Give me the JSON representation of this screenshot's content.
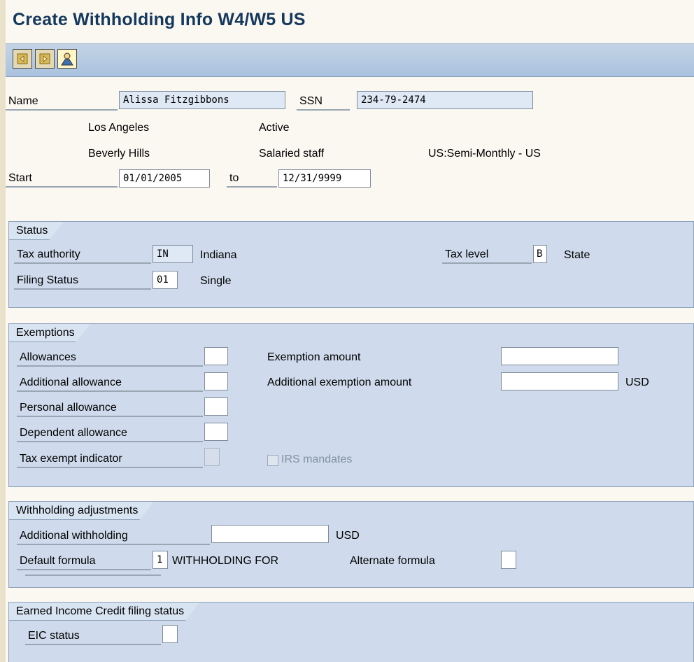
{
  "header": {
    "title": "Create Withholding Info W4/W5 US"
  },
  "toolbar": {
    "buttons": [
      "previous-icon",
      "next-icon",
      "person-icon"
    ]
  },
  "person": {
    "name_label": "Name",
    "name_value": "Alissa Fitzgibbons",
    "ssn_label": "SSN",
    "ssn_value": "234-79-2474",
    "city": "Los Angeles",
    "status_text": "Active",
    "area": "Beverly Hills",
    "employee_group": "Salaried staff",
    "payroll_area": "US:Semi-Monthly - US",
    "start_label": "Start",
    "start_value": "01/01/2005",
    "to_label": "to",
    "end_value": "12/31/9999"
  },
  "status": {
    "title": "Status",
    "tax_authority_label": "Tax authority",
    "tax_authority_code": "IN",
    "tax_authority_text": "Indiana",
    "tax_level_label": "Tax level",
    "tax_level_code": "B",
    "tax_level_text": "State",
    "filing_status_label": "Filing Status",
    "filing_status_code": "01",
    "filing_status_text": "Single"
  },
  "exemptions": {
    "title": "Exemptions",
    "allowances_label": "Allowances",
    "allowances_value": "",
    "additional_allowance_label": "Additional allowance",
    "additional_allowance_value": "",
    "personal_allowance_label": "Personal allowance",
    "personal_allowance_value": "",
    "dependent_allowance_label": "Dependent allowance",
    "dependent_allowance_value": "",
    "tax_exempt_label": "Tax exempt indicator",
    "tax_exempt_value": "",
    "exemption_amount_label": "Exemption amount",
    "exemption_amount_value": "",
    "additional_exemption_label": "Additional exemption amount",
    "additional_exemption_value": "",
    "currency": "USD",
    "irs_mandates_label": "IRS mandates"
  },
  "withholding": {
    "title": "Withholding adjustments",
    "additional_withholding_label": "Additional withholding",
    "additional_withholding_value": "",
    "currency": "USD",
    "default_formula_label": "Default formula",
    "default_formula_value": "1",
    "default_formula_text": "WITHHOLDING FOR",
    "alternate_formula_label": "Alternate formula",
    "alternate_formula_value": ""
  },
  "eic": {
    "title": "Earned Income Credit filing status",
    "eic_status_label": "EIC status",
    "eic_status_value": ""
  },
  "colors": {
    "title": "#15385d",
    "group_bg": "#cfdbec",
    "toolbar_bg": "#aac2de",
    "page_bg": "#fbf8f1"
  }
}
